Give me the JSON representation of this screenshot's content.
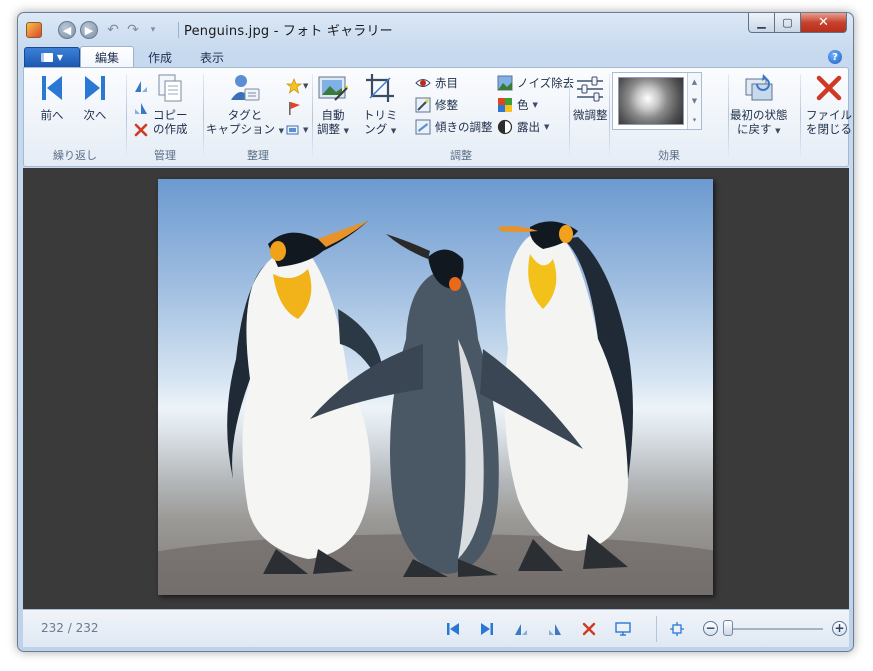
{
  "window": {
    "title": "Penguins.jpg - フォト ギャラリー"
  },
  "tabs": [
    {
      "label": "編集"
    },
    {
      "label": "作成"
    },
    {
      "label": "表示"
    }
  ],
  "ribbon": {
    "navigate": {
      "group_label": "繰り返し",
      "prev_label": "前へ",
      "next_label": "次へ"
    },
    "manage": {
      "group_label": "管理",
      "copy_label_line1": "コピー",
      "copy_label_line2": "の作成"
    },
    "organize": {
      "group_label": "整理",
      "tag_label_line1": "タグと",
      "tag_label_line2": "キャプション"
    },
    "adjust": {
      "group_label": "調整",
      "auto_label_line1": "自動",
      "auto_label_line2": "調整",
      "crop_label_line1": "トリミ",
      "crop_label_line2": "ング",
      "redeye_label": "赤目",
      "retouch_label": "修整",
      "straighten_label": "傾きの調整",
      "noise_label": "ノイズ除去",
      "color_label": "色",
      "exposure_label": "露出",
      "fine_tune_label": "微調整"
    },
    "effects": {
      "group_label": "効果"
    },
    "revert": {
      "label_line1": "最初の状態",
      "label_line2": "に戻す"
    },
    "close": {
      "label_line1": "ファイル",
      "label_line2": "を閉じる"
    }
  },
  "statusbar": {
    "counter": "232 / 232",
    "zoom_level": 0.05
  },
  "colors": {
    "accent": "#1c58b3",
    "close_red": "#c7422c",
    "viewer_bg": "#3a3a3a"
  }
}
